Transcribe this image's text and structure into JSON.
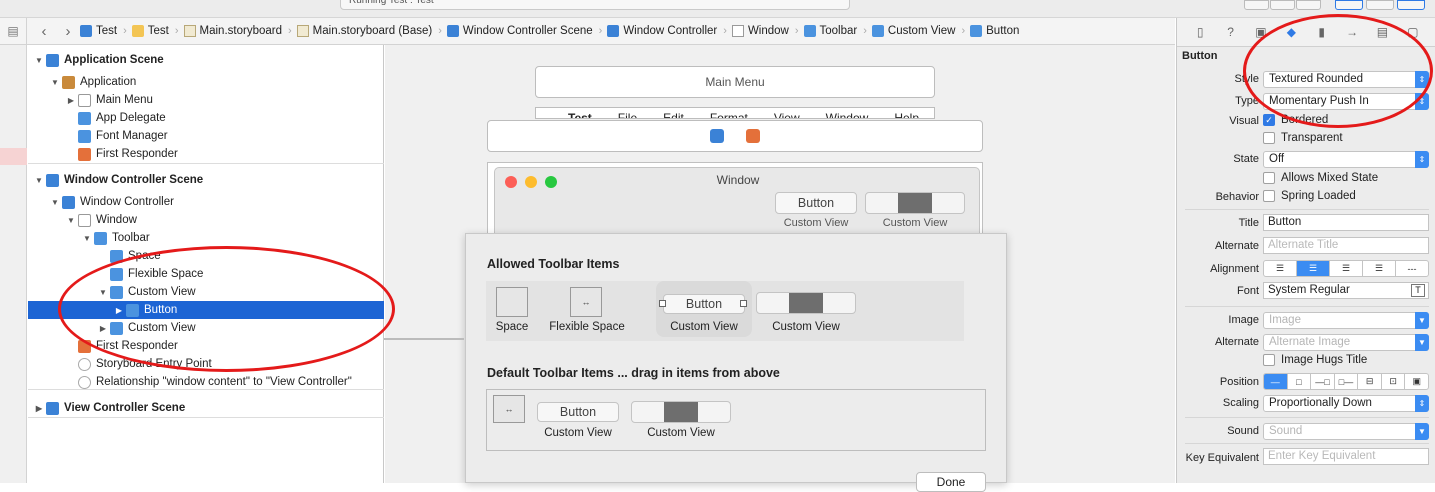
{
  "status_text": "Running Test : Test",
  "breadcrumbs": [
    {
      "label": "Test",
      "icon": "app-icon"
    },
    {
      "label": "Test",
      "icon": "folder-icon"
    },
    {
      "label": "Main.storyboard",
      "icon": "storyboard-icon"
    },
    {
      "label": "Main.storyboard (Base)",
      "icon": "storyboard-icon"
    },
    {
      "label": "Window Controller Scene",
      "icon": "scene-icon"
    },
    {
      "label": "Window Controller",
      "icon": "window-controller-icon"
    },
    {
      "label": "Window",
      "icon": "window-icon"
    },
    {
      "label": "Toolbar",
      "icon": "cube-icon"
    },
    {
      "label": "Custom View",
      "icon": "cube-icon"
    },
    {
      "label": "Button",
      "icon": "button-icon"
    }
  ],
  "outline": {
    "rows": [
      {
        "label": "Application Scene",
        "icon": "scene-icon",
        "indent": 0,
        "tri": "▼",
        "bold": true
      },
      {
        "label": "Application",
        "icon": "application-icon",
        "indent": 1,
        "tri": "▼"
      },
      {
        "label": "Main Menu",
        "icon": "menu-icon",
        "indent": 2,
        "tri": "▶"
      },
      {
        "label": "App Delegate",
        "icon": "cube-icon",
        "indent": 2,
        "tri": ""
      },
      {
        "label": "Font Manager",
        "icon": "cube-icon",
        "indent": 2,
        "tri": ""
      },
      {
        "label": "First Responder",
        "icon": "responder-icon",
        "indent": 2,
        "tri": ""
      },
      {
        "label": "Window Controller Scene",
        "icon": "scene-icon",
        "indent": 0,
        "tri": "▼",
        "bold": true
      },
      {
        "label": "Window Controller",
        "icon": "window-controller-icon",
        "indent": 1,
        "tri": "▼"
      },
      {
        "label": "Window",
        "icon": "window-icon",
        "indent": 2,
        "tri": "▼"
      },
      {
        "label": "Toolbar",
        "icon": "cube-icon",
        "indent": 3,
        "tri": "▼"
      },
      {
        "label": "Space",
        "icon": "cube-icon",
        "indent": 4,
        "tri": ""
      },
      {
        "label": "Flexible Space",
        "icon": "cube-icon",
        "indent": 4,
        "tri": ""
      },
      {
        "label": "Custom View",
        "icon": "cube-icon",
        "indent": 4,
        "tri": "▼"
      },
      {
        "label": "Button",
        "icon": "button-icon",
        "indent": 5,
        "tri": "▶",
        "selected": true
      },
      {
        "label": "Custom View",
        "icon": "cube-icon",
        "indent": 4,
        "tri": "▶"
      },
      {
        "label": "First Responder",
        "icon": "responder-icon",
        "indent": 2,
        "tri": ""
      },
      {
        "label": "Storyboard Entry Point",
        "icon": "arrow-icon",
        "indent": 2,
        "tri": ""
      },
      {
        "label": "Relationship \"window content\" to \"View Controller\"",
        "icon": "relationship-icon",
        "indent": 2,
        "tri": ""
      },
      {
        "label": "View Controller Scene",
        "icon": "scene-icon",
        "indent": 0,
        "tri": "▶",
        "bold": true
      }
    ]
  },
  "canvas": {
    "main_menu_title": "Main Menu",
    "menubar_items": [
      "Test",
      "File",
      "Edit",
      "Format",
      "View",
      "Window",
      "Help"
    ],
    "window_title": "Window",
    "toolbar_button_label": "Button",
    "toolbar_custom_view_label_1": "Custom View",
    "toolbar_custom_view_label_2": "Custom View",
    "sheet": {
      "allowed_title": "Allowed Toolbar Items",
      "default_title": "Default Toolbar Items ... drag in items from above",
      "allowed_items": [
        "Space",
        "Flexible Space",
        "Custom View",
        "Custom View"
      ],
      "allowed_button_label": "Button",
      "default_button_label": "Button",
      "default_items": [
        "Custom View",
        "Custom View"
      ],
      "done_label": "Done"
    }
  },
  "inspector": {
    "section_title": "Button",
    "style_label": "Style",
    "style_value": "Textured Rounded",
    "type_label": "Type",
    "type_value": "Momentary Push In",
    "visual_label": "Visual",
    "bordered_label": "Bordered",
    "transparent_label": "Transparent",
    "state_label": "State",
    "state_value": "Off",
    "allows_mixed_label": "Allows Mixed State",
    "behavior_label": "Behavior",
    "spring_loaded_label": "Spring Loaded",
    "title_label": "Title",
    "title_value": "Button",
    "alternate_label": "Alternate",
    "alternate_placeholder": "Alternate Title",
    "alignment_label": "Alignment",
    "font_label": "Font",
    "font_value": "System Regular",
    "image_label": "Image",
    "image_placeholder": "Image",
    "alt_image_label": "Alternate",
    "alt_image_placeholder": "Alternate Image",
    "image_hugs_label": "Image Hugs Title",
    "position_label": "Position",
    "scaling_label": "Scaling",
    "scaling_value": "Proportionally Down",
    "sound_label": "Sound",
    "sound_placeholder": "Sound",
    "key_equiv_label": "Key Equivalent",
    "key_equiv_placeholder": "Enter Key Equivalent"
  },
  "colors": {
    "selection": "#1c64d4",
    "accent": "#3b8cf2",
    "annotation": "#e41a1a"
  }
}
